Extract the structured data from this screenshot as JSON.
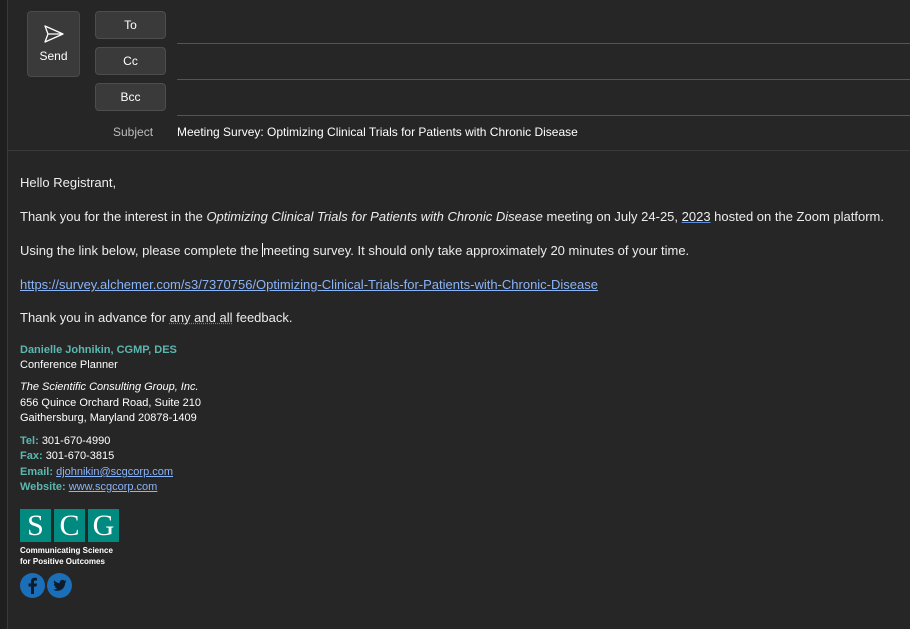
{
  "toolbar": {
    "send_label": "Send",
    "to_label": "To",
    "cc_label": "Cc",
    "bcc_label": "Bcc"
  },
  "fields": {
    "to_value": "",
    "cc_value": "",
    "bcc_value": "",
    "subject_label": "Subject",
    "subject_value": "Meeting Survey: Optimizing Clinical Trials for Patients with Chronic Disease"
  },
  "message": {
    "greeting": "Hello Registrant,",
    "p1_a": "Thank you for the interest in the ",
    "p1_em": "Optimizing Clinical Trials for Patients with Chronic Disease",
    "p1_b": " meeting on July 24-25, ",
    "p1_year": "2023",
    "p1_c": " hosted on the Zoom platform.",
    "p2_a": "Using the link below, please complete the ",
    "p2_b": "meeting survey. It should only take approximately 20 minutes of your time.",
    "survey_link": "https://survey.alchemer.com/s3/7370756/Optimizing-Clinical-Trials-for-Patients-with-Chronic-Disease",
    "p3_a": "Thank you in advance for ",
    "p3_squig": "any and all",
    "p3_b": " feedback."
  },
  "signature": {
    "name": "Danielle Johnikin, CGMP, DES",
    "title": "Conference Planner",
    "company": "The Scientific Consulting Group, Inc.",
    "address1": "656 Quince Orchard Road, Suite 210",
    "address2": "Gaithersburg, Maryland 20878-1409",
    "tel_label": "Tel:",
    "tel": "301-670-4990",
    "fax_label": "Fax:",
    "fax": "301-670-3815",
    "email_label": "Email:",
    "email": "djohnikin@scgcorp.com",
    "website_label": "Website:",
    "website": "www.scgcorp.com",
    "logo_letters": [
      "S",
      "C",
      "G"
    ],
    "tagline1": "Communicating Science",
    "tagline2": "for Positive Outcomes"
  },
  "colors": {
    "background": "#262626",
    "accent_teal": "#5bb7b0",
    "logo_teal": "#008a80",
    "link": "#8ab4f8",
    "social_blue": "#1a6fb8"
  },
  "icons": [
    "send-icon",
    "facebook-icon",
    "twitter-icon"
  ]
}
